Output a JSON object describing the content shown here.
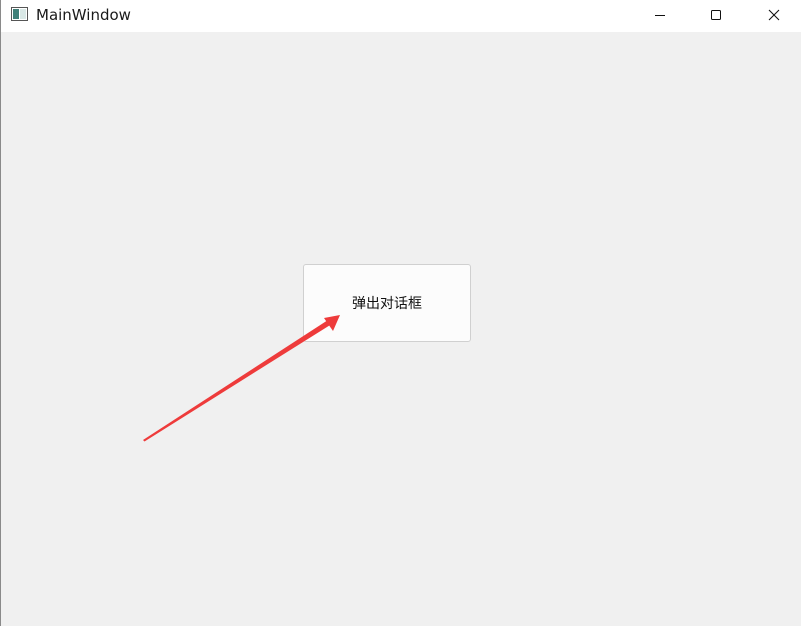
{
  "window": {
    "title": "MainWindow",
    "app_icon": "window-app-icon",
    "controls": {
      "minimize_icon": "minimize-icon",
      "maximize_icon": "maximize-icon",
      "close_icon": "close-icon"
    }
  },
  "main": {
    "popup_button_label": "弹出对话框"
  },
  "annotation": {
    "arrow_color": "#ee3b3b"
  },
  "colors": {
    "client_background": "#f0f0f0",
    "titlebar_background": "#ffffff",
    "button_background": "#fcfcfc",
    "button_border": "#d0d0d0"
  }
}
